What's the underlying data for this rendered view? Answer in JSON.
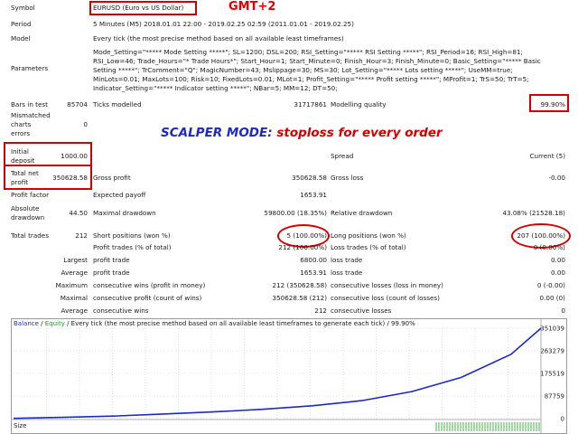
{
  "header": {
    "symbol_label": "Symbol",
    "symbol_value": "EURUSD (Euro vs US Dollar)",
    "gmt_note": "GMT+2",
    "period_label": "Period",
    "period_value": "5 Minutes (M5) 2018.01.01 22:00 - 2019.02.25 02:59 (2011.01.01 - 2019.02.25)",
    "model_label": "Model",
    "model_value": "Every tick (the most precise method based on all available least timeframes)",
    "parameters_label": "Parameters",
    "parameters_lines": [
      "Mode_Setting=\"***** Mode Setting *****\"; SL=1200; DSL=200; RSI_Setting=\"***** RSI Setting *****\"; RSI_Period=16; RSI_High=81;",
      "RSI_Low=46; Trade_Hours=\"* Trade Hours*\"; Start_Hour=1; Start_Minute=0; Finish_Hour=3; Finish_Minute=0; Basic_Setting=\"***** Basic",
      "Setting *****\"; TrComment=\"Q\"; MagicNumber=43; Mslippage=30; MS=30; Lot_Setting=\"***** Lots setting *****\"; UseMM=true;",
      "MinLots=0.01; MaxLots=100; Risk=10; FixedLots=0.01; MLot=1; Profit_Setting=\"***** Profit setting *****\"; MProfit=1; TrS=50; TrT=5;",
      "Indicator_Setting=\"***** Indicator setting *****\"; NBar=5; MM=12; DT=50;"
    ]
  },
  "bars": {
    "bars_label": "Bars in test",
    "bars_value": "85704",
    "ticks_label": "Ticks modelled",
    "ticks_value": "31717861",
    "quality_label": "Modelling quality",
    "quality_value": "99.90%"
  },
  "mismatch": {
    "label_lines": [
      "Mismatched",
      "charts",
      "errors"
    ],
    "value": "0"
  },
  "scalper": {
    "prefix": "SCALPER MODE:",
    "suffix": "stoploss for every order",
    "prefix_color": "#1c2bbf",
    "suffix_color": "#d40000"
  },
  "deposit": {
    "initial_label_lines": [
      "Initial",
      "deposit"
    ],
    "initial_value": "1000.00",
    "spread_label": "Spread",
    "spread_value": "Current (5)",
    "net_label_lines": [
      "Total net",
      "profit"
    ],
    "net_value": "350628.58",
    "gross_profit_label": "Gross profit",
    "gross_profit_value": "350628.58",
    "gross_loss_label": "Gross loss",
    "gross_loss_value": "-0.00"
  },
  "stats": {
    "profit_factor_label": "Profit factor",
    "expected_payoff_label": "Expected payoff",
    "expected_payoff_value": "1653.91",
    "abs_drawdown_label_lines": [
      "Absolute",
      "drawdown"
    ],
    "abs_drawdown_value": "44.50",
    "max_drawdown_label": "Maximal drawdown",
    "max_drawdown_value": "59800.00 (18.35%)",
    "rel_drawdown_label": "Relative drawdown",
    "rel_drawdown_value": "43.08% (21528.18)"
  },
  "trades": {
    "total_label": "Total trades",
    "total_value": "212",
    "short_label": "Short positions (won %)",
    "short_value": "5 (100.00%)",
    "long_label": "Long positions (won %)",
    "long_value": "207 (100.00%)",
    "rows": [
      {
        "lead": "",
        "left_label": "Profit trades (% of total)",
        "left_value": "212 (100.00%)",
        "right_label": "Loss trades (% of total)",
        "right_value": "0 (0.00%)"
      },
      {
        "lead": "Largest",
        "left_label": "profit trade",
        "left_value": "6800.00",
        "right_label": "loss trade",
        "right_value": "0.00"
      },
      {
        "lead": "Average",
        "left_label": "profit trade",
        "left_value": "1653.91",
        "right_label": "loss trade",
        "right_value": "0.00"
      },
      {
        "lead": "Maximum",
        "left_label": "consecutive wins (profit in money)",
        "left_value": "212 (350628.58)",
        "right_label": "consecutive losses (loss in money)",
        "right_value": "0 (-0.00)"
      },
      {
        "lead": "Maximal",
        "left_label": "consecutive profit (count of wins)",
        "left_value": "350628.58 (212)",
        "right_label": "consecutive loss (count of losses)",
        "right_value": "0.00 (0)"
      },
      {
        "lead": "Average",
        "left_label": "consecutive wins",
        "left_value": "212",
        "right_label": "consecutive losses",
        "right_value": "0"
      }
    ]
  },
  "chart": {
    "legend_balance": "Balance",
    "legend_sep1": " / ",
    "legend_equity": "Equity",
    "legend_rest": " / Every tick (the most precise method based on all available least timeframes to generate each tick) / 99.90%",
    "balance_color": "#1c2bbf",
    "equity_color": "#18a018",
    "size_label": "Size",
    "y_ticks": [
      "351039",
      "263279",
      "175519",
      "87759",
      "0"
    ]
  },
  "chart_data": {
    "type": "line",
    "x": [
      0,
      20,
      40,
      60,
      80,
      100,
      120,
      140,
      160,
      180,
      200,
      212
    ],
    "series": [
      {
        "name": "Balance",
        "values": [
          1000,
          5000,
          10000,
          18000,
          26000,
          36000,
          50000,
          70000,
          105000,
          160000,
          250000,
          351039
        ]
      },
      {
        "name": "Equity",
        "values": [
          1000,
          5000,
          10000,
          18000,
          26000,
          36000,
          50000,
          70000,
          105000,
          160000,
          250000,
          351039
        ]
      }
    ],
    "ylim": [
      0,
      351039
    ],
    "y_ticks": [
      0,
      87759,
      175519,
      263279,
      351039
    ]
  }
}
